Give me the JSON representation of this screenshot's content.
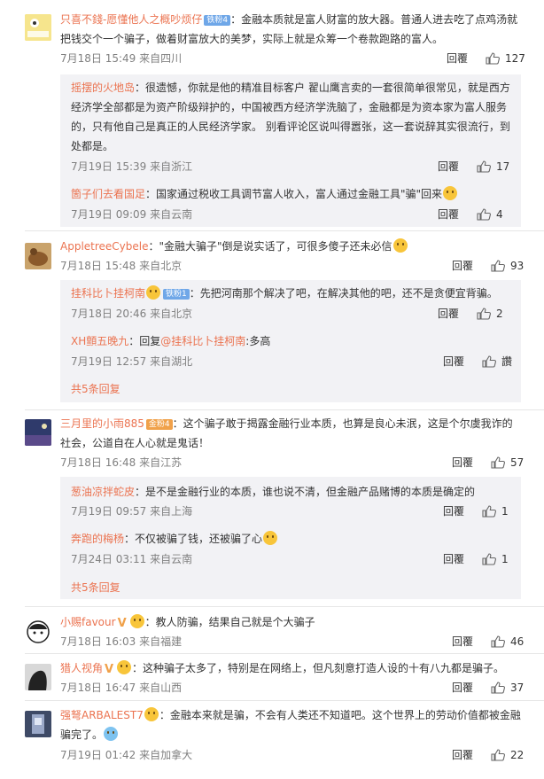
{
  "reply_label": "回覆",
  "colors": {
    "accent": "#eb7350",
    "reply_bg": "#f2f2f5",
    "meta": "#808080"
  },
  "comments": [
    {
      "user": "只喜不錢-愿懂他人之概吵烦仔",
      "badge": "铁粉4",
      "text": "：金融本质就是富人财富的放大器。普通人进去吃了点鸡汤就把钱交个一个骗子，做着财富放大的美梦，实际上就是众筹一个卷款跑路的富人。",
      "meta": "7月18日 15:49 来自四川",
      "likes": "127",
      "replies": [
        {
          "user": "摇摆的火地岛",
          "text": "：很遗憾，你就是他的精准目标客户 翟山鹰言卖的一套很简单很常见，就是西方经济学全部都是为资产阶级辩护的，中国被西方经济学洗脑了，金融都是为资本家为富人服务的，只有他自己是真正的人民经济学家。 别看评论区说叫得嚣张，这一套说辞其实很流行，到处都是。",
          "meta": "7月19日 15:39 来自浙江",
          "likes": "17"
        },
        {
          "user": "箇子们去看国足",
          "text": "：国家通过税收工具调节富人收入，富人通过金融工具\"骗\"回来",
          "meta": "7月19日 09:09 来自云南",
          "likes": "4"
        }
      ]
    },
    {
      "user": "AppletreeCybele",
      "text": "：\"金融大骗子\"倒是说实话了，可很多傻子还未必信",
      "meta": "7月18日 15:48 来自北京",
      "likes": "93",
      "replies": [
        {
          "user": "挂科比卜挂柯南",
          "badge": "铁粉1",
          "text": "：先把河南那个解决了吧，在解决其他的吧，还不是贪便宜背骗。",
          "meta": "7月18日 20:46 来自北京",
          "likes": "2"
        },
        {
          "user": "XH顫五晚九",
          "text_prefix": "：回复",
          "mention": "@挂科比卜挂柯南",
          "text": ":多高",
          "meta": "7月19日 12:57 来自湖北",
          "likes": "讚"
        }
      ],
      "more": "共5条回复"
    },
    {
      "user": "三月里的小雨885",
      "badge": "金粉4",
      "text": "：这个骗子敢于揭露金融行业本质，也算是良心未泯，这是个尔虞我诈的社会，公道自在人心就是鬼话！",
      "meta": "7月18日 16:48 来自江苏",
      "likes": "57",
      "replies": [
        {
          "user": "葱油凉拌蛇皮",
          "text": "：是不是金融行业的本质，谁也说不清，但金融产品赌博的本质是确定的",
          "meta": "7月19日 09:57 来自上海",
          "likes": "1"
        },
        {
          "user": "奔跑的梅杨",
          "text": "：不仅被骗了钱，还被骗了心",
          "meta": "7月24日 03:11 来自云南",
          "likes": "1"
        }
      ],
      "more": "共5条回复"
    },
    {
      "user": "小赐favour",
      "text": "：教人防骗，结果自己就是个大骗子",
      "meta": "7月18日 16:03 来自福建",
      "likes": "46"
    },
    {
      "user": "猎人视角",
      "text": "：这种骗子太多了，特别是在网络上，但凡刻意打造人设的十有八九都是骗子。",
      "meta": "7月18日 16:47 来自山西",
      "likes": "37"
    },
    {
      "user": "强弩ARBALEST7",
      "text": "：金融本来就是骗，不会有人类还不知道吧。这个世界上的劳动价值都被金融骗完了。",
      "meta": "7月19日 01:42 来自加拿大",
      "likes": "22"
    }
  ]
}
